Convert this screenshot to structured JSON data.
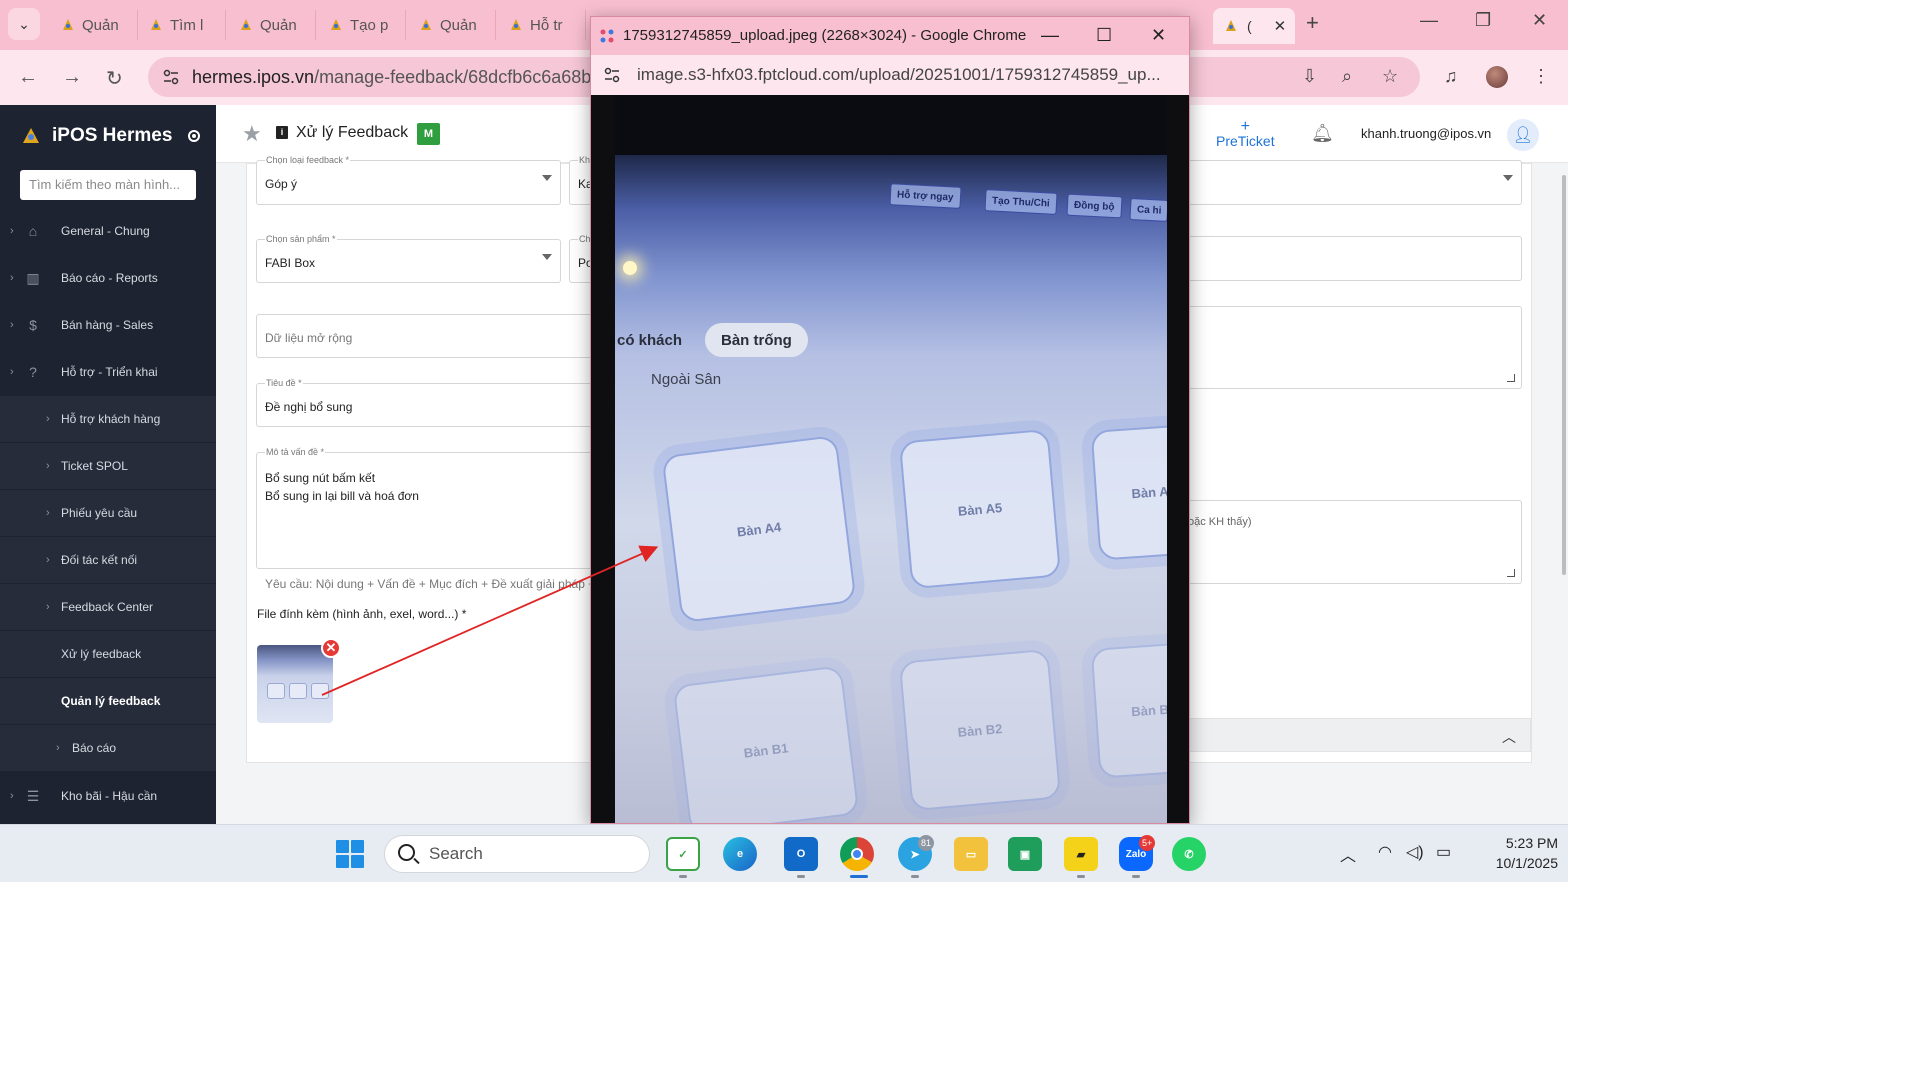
{
  "browser": {
    "tabs": [
      {
        "label": "Quản"
      },
      {
        "label": "Tìm l"
      },
      {
        "label": "Quản"
      },
      {
        "label": "Tạo p"
      },
      {
        "label": "Quản"
      },
      {
        "label": "Hỗ tr"
      }
    ],
    "active_tab_label": "(",
    "url_host": "hermes.ipos.vn",
    "url_path": "/manage-feedback/68dcfb6c6a68b70"
  },
  "sidebar": {
    "brand": "iPOS Hermes",
    "search_placeholder": "Tìm kiếm theo màn hình...",
    "items": [
      {
        "label": "General - Chung",
        "icon": "home-icon"
      },
      {
        "label": "Báo cáo - Reports",
        "icon": "chart-icon"
      },
      {
        "label": "Bán hàng - Sales",
        "icon": "dollar-icon"
      },
      {
        "label": "Hỗ trợ - Triển khai",
        "icon": "help-icon"
      },
      {
        "label": "Hỗ trợ khách hàng"
      },
      {
        "label": "Ticket SPOL"
      },
      {
        "label": "Phiếu yêu cầu"
      },
      {
        "label": "Đối tác kết nối"
      },
      {
        "label": "Feedback Center"
      },
      {
        "label": "Xử lý feedback"
      },
      {
        "label": "Quản lý feedback"
      },
      {
        "label": "Báo cáo"
      },
      {
        "label": "Kho bãi - Hậu cần",
        "icon": "list-icon"
      }
    ]
  },
  "header": {
    "title": "Xử lý Feedback",
    "badge": "M",
    "preticket_plus": "+",
    "preticket_label": "PreTicket",
    "user_email": "khanh.truong@ipos.vn"
  },
  "form": {
    "feedback_type": {
      "label": "Chọn loại feedback *",
      "value": "Góp ý"
    },
    "feedback_type_right": {
      "label": "Kh",
      "value": "Ka"
    },
    "product": {
      "label": "Chọn sản phẩm *",
      "value": "FABI Box"
    },
    "product_right": {
      "label": "Ch",
      "value": "Po"
    },
    "extended_data_placeholder": "Dữ liệu mở rộng",
    "subject": {
      "label": "Tiêu đề *",
      "value": "Đề nghị bổ sung"
    },
    "description": {
      "label": "Mô tả vấn đề *",
      "value": "Bổ sung nút bấm kết\nBổ sung in lại bill và hoá đơn"
    },
    "hint": "Yêu cầu: Nội dung + Vấn đề + Mục đích + Đề xuất giải pháp + F",
    "attachment_label": "File đính kèm (hình ảnh, exel, word...) *",
    "right_hint": "oặc KH thấy)"
  },
  "popup": {
    "title": "1759312745859_upload.jpeg (2268×3024) - Google Chrome",
    "url": "image.s3-hfx03.fptcloud.com/upload/20251001/1759312745859_up..."
  },
  "photo": {
    "toolbar_chips": [
      "Hỗ trợ ngay",
      "Tạo Thu/Chi",
      "Đồng bộ",
      "Ca hi"
    ],
    "filter_pills": [
      "có khách",
      "Bàn trống"
    ],
    "area_heading": "Ngoài Sân",
    "tables": [
      "Bàn A4",
      "Bàn A5",
      "Bàn A",
      "Bàn B1",
      "Bàn B2",
      "Bàn B"
    ]
  },
  "taskbar": {
    "search_label": "Search",
    "telegram_badge": "81",
    "zalo_badge": "5+",
    "time": "5:23 PM",
    "date": "10/1/2025"
  },
  "colors": {
    "chrome_pink": "#f8bfd0",
    "sidebar_bg": "#1d2330",
    "accent_blue": "#1e73d6",
    "badge_green": "#2e9e3e",
    "annotation_red": "#e02424"
  }
}
